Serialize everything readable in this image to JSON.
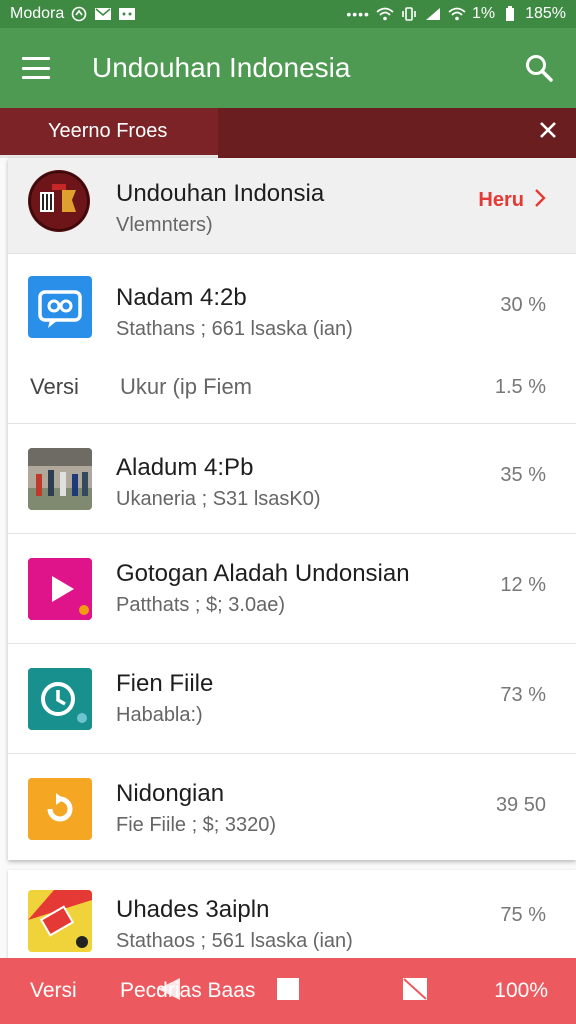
{
  "status_bar": {
    "carrier": "Modora",
    "battery": "185%",
    "signal": "1%"
  },
  "app_bar": {
    "title": "Undouhan Indonesia"
  },
  "tab": {
    "label": "Yeerno Froes"
  },
  "header_row": {
    "name": "Undouhan Indonsia",
    "sub": "Vlemnters)",
    "action": "Heru"
  },
  "rows": [
    {
      "name": "Nadam 4:2b",
      "sub": "Stathans ; 661 lsaska (ian)",
      "pct": "30 %",
      "extra_left": "Versi",
      "extra_mid": "Ukur (ip  Fiem",
      "extra_pct": "1.5 %"
    },
    {
      "name": "Aladum 4:Pb",
      "sub": "Ukaneria ; S31 lsasK0)",
      "pct": "35 %"
    },
    {
      "name": "Gotogan Aladah Undonsian",
      "sub": "Patthats ; $; 3.0ae)",
      "pct": "12 %"
    },
    {
      "name": "Fien Fiile",
      "sub": "Hababla:)",
      "pct": "73 %"
    },
    {
      "name": "Nidongian",
      "sub": "Fie Fiile ; $; 3320)",
      "pct": "39 50"
    }
  ],
  "bottom_row": {
    "name": "Uhades 3aipln",
    "sub": "Stathaos ; 561 lsaska (ian)",
    "pct": "75 %"
  },
  "bottom_bar": {
    "left": "Versi",
    "middle": "Pecdrias Baas",
    "right": "100%"
  },
  "colors": {
    "status_green": "#3f8a43",
    "app_green": "#4e9a52",
    "tab_maroon": "#6b1e20",
    "accent_red": "#e53935",
    "bottom_red": "#ec5a5f"
  }
}
